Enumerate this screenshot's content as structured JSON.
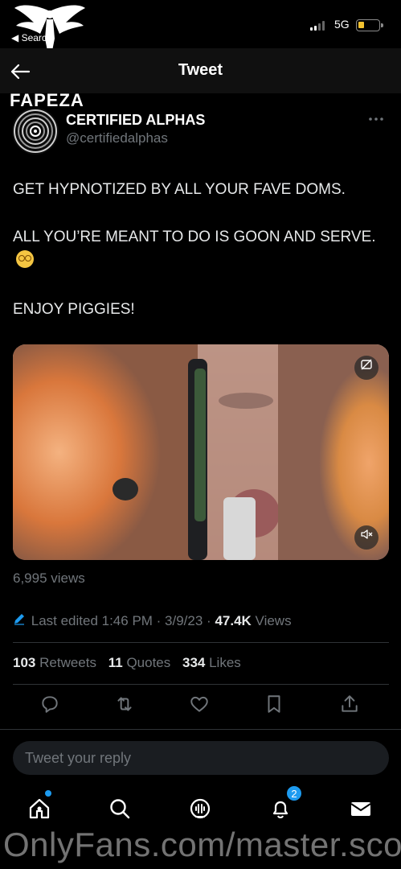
{
  "status_bar": {
    "back_label": "◀ Search",
    "network": "5G",
    "battery_level": 0.2,
    "battery_color": "#f2c230"
  },
  "watermark": {
    "logo_text": "FAPEZA",
    "url_text": "OnlyFans.com/master.scott"
  },
  "header": {
    "back_icon": "arrow-left-icon",
    "title": "Tweet"
  },
  "author": {
    "display_name": "CERTIFIED ALPHAS",
    "username": "@certifiedalphas",
    "more_icon": "more-horizontal-icon"
  },
  "tweet": {
    "paragraphs": [
      "GET HYPNOTIZED BY ALL YOUR FAVE DOMS.",
      "ALL YOU’RE MEANT TO DO IS GOON AND SERVE.",
      "ENJOY PIGGIES!"
    ],
    "emoji_icon": "dizzy-face-emoji-icon"
  },
  "media": {
    "type": "video",
    "top_right_icon": "content-warning-icon",
    "bottom_right_icon": "mute-icon"
  },
  "meta": {
    "views": "6,995 views",
    "edited_label": "Last edited 1:46 PM · 3/9/23 ·",
    "total_views_value": "47.4K",
    "total_views_label": "Views"
  },
  "stats": [
    {
      "value": "103",
      "label": "Retweets"
    },
    {
      "value": "11",
      "label": "Quotes"
    },
    {
      "value": "334",
      "label": "Likes"
    }
  ],
  "actions": [
    "reply-icon",
    "retweet-icon",
    "like-icon",
    "bookmark-icon",
    "share-icon"
  ],
  "reply": {
    "placeholder": "Tweet your reply"
  },
  "bottom_nav": {
    "items": [
      "home-icon",
      "search-icon",
      "spaces-icon",
      "notifications-icon",
      "messages-icon"
    ],
    "notification_count": "2"
  },
  "colors": {
    "accent": "#1d9bf0",
    "background": "#000000",
    "text_primary": "#e7e9ea",
    "text_secondary": "#71767b"
  }
}
